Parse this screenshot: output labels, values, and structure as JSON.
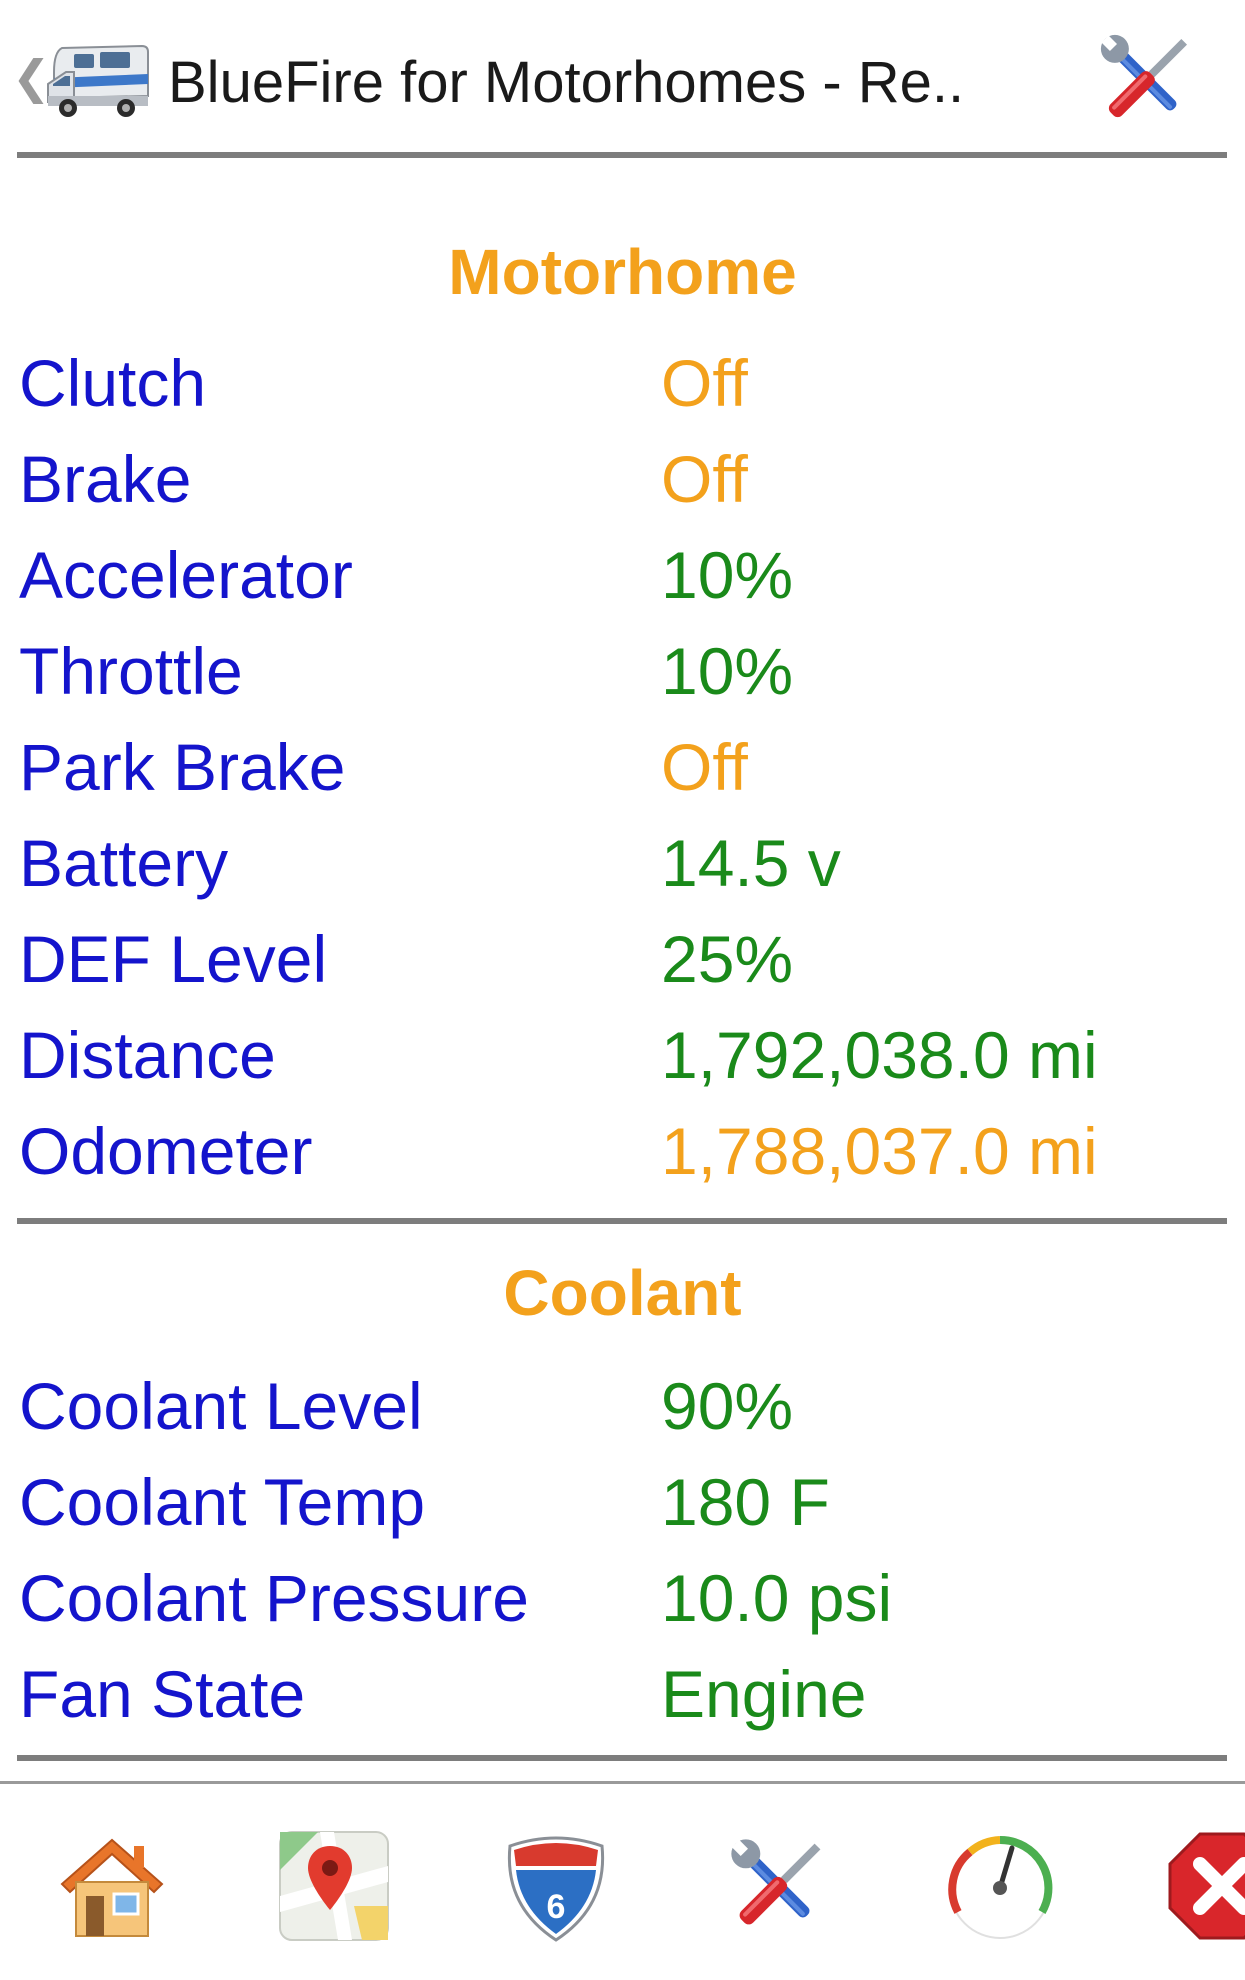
{
  "header": {
    "title": "BlueFire for Motorhomes - Re..",
    "back_icon": "chevron-left-icon",
    "app_icon": "motorhome-icon",
    "settings_icon": "tools-icon"
  },
  "sections": [
    {
      "title": "Motorhome",
      "rows": [
        {
          "label": "Clutch",
          "value": "Off",
          "status": "orange"
        },
        {
          "label": "Brake",
          "value": "Off",
          "status": "orange"
        },
        {
          "label": "Accelerator",
          "value": "10%",
          "status": "green"
        },
        {
          "label": "Throttle",
          "value": "10%",
          "status": "green"
        },
        {
          "label": "Park Brake",
          "value": "Off",
          "status": "orange"
        },
        {
          "label": "Battery",
          "value": "14.5 v",
          "status": "green"
        },
        {
          "label": "DEF Level",
          "value": "25%",
          "status": "green"
        },
        {
          "label": "Distance",
          "value": "1,792,038.0 mi",
          "status": "green"
        },
        {
          "label": "Odometer",
          "value": "1,788,037.0 mi",
          "status": "orange"
        }
      ]
    },
    {
      "title": "Coolant",
      "rows": [
        {
          "label": "Coolant Level",
          "value": "90%",
          "status": "green"
        },
        {
          "label": "Coolant Temp",
          "value": "180 F",
          "status": "green"
        },
        {
          "label": "Coolant Pressure",
          "value": "10.0 psi",
          "status": "green"
        },
        {
          "label": "Fan State",
          "value": "Engine",
          "status": "green"
        }
      ]
    }
  ],
  "toolbar": {
    "items": [
      {
        "icon": "home-icon"
      },
      {
        "icon": "map-icon"
      },
      {
        "icon": "interstate-shield-icon",
        "text": "6"
      },
      {
        "icon": "tools-icon"
      },
      {
        "icon": "gauge-icon"
      },
      {
        "icon": "close-icon"
      }
    ]
  },
  "colors": {
    "label": "#1414cc",
    "orange": "#f3a11c",
    "green": "#1a8a1a",
    "rule": "#7d7d7d"
  }
}
